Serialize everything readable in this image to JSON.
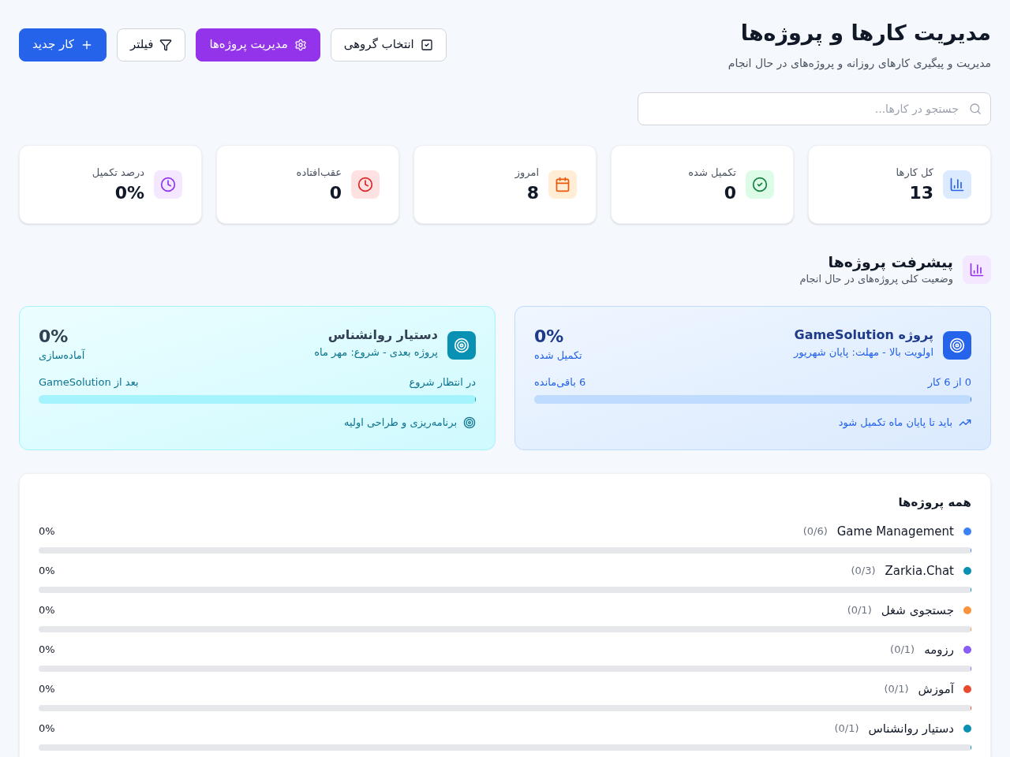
{
  "header": {
    "title": "مدیریت کارها و پروژه‌ها",
    "subtitle": "مدیریت و پیگیری کارهای روزانه و پروژه‌های در حال انجام"
  },
  "toolbar": [
    {
      "label": "انتخاب گروهی",
      "kind": "outline"
    },
    {
      "label": "مدیریت پروژه‌ها",
      "kind": "accent"
    },
    {
      "label": "فیلتر",
      "kind": "outline"
    },
    {
      "label": "کار جدید",
      "kind": "primary"
    }
  ],
  "search": {
    "placeholder": "جستجو در کارها..."
  },
  "stats": [
    {
      "label": "کل کارها",
      "value": "13"
    },
    {
      "label": "تکمیل شده",
      "value": "0"
    },
    {
      "label": "امروز",
      "value": "8"
    },
    {
      "label": "عقب‌افتاده",
      "value": "0"
    },
    {
      "label": "درصد تکمیل",
      "value": "0%"
    }
  ],
  "progress_section": {
    "title": "پیشرفت پروژه‌ها",
    "subtitle": "وضعیت کلی پروژه‌های در حال انجام"
  },
  "project_cards": [
    {
      "kind": "active",
      "title": "پروژه GameSolution",
      "subtitle": "اولویت بالا - مهلت: پایان شهریور",
      "percent": "0%",
      "status": "تکمیل شده",
      "progress_label": "0 از 6 کار",
      "progress_note": "6 باقی‌مانده",
      "level": 0,
      "footer": "باید تا پایان ماه تکمیل شود"
    },
    {
      "kind": "upcoming",
      "title": "دستیار روانشناس",
      "subtitle": "پروژه بعدی - شروع: مهر ماه",
      "percent": "0%",
      "status": "آماده‌سازی",
      "progress_label": "در انتظار شروع",
      "progress_note": "بعد از GameSolution",
      "level": 0,
      "footer": "برنامه‌ریزی و طراحی اولیه"
    }
  ],
  "all_projects": {
    "title": "همه پروژه‌ها",
    "rows": [
      {
        "name": "Game Management",
        "count": "(0/6)",
        "percent": "0%",
        "level": 0,
        "color": "#3b82f6"
      },
      {
        "name": "Zarkia.Chat",
        "count": "(0/3)",
        "percent": "0%",
        "level": 0,
        "color": "#0891b2"
      },
      {
        "name": "جستجوی شغل",
        "count": "(0/1)",
        "percent": "0%",
        "level": 0,
        "color": "#fb923c"
      },
      {
        "name": "رزومه",
        "count": "(0/1)",
        "percent": "0%",
        "level": 0,
        "color": "#8b5cf6"
      },
      {
        "name": "آموزش",
        "count": "(0/1)",
        "percent": "0%",
        "level": 0,
        "color": "#ea4a2f"
      },
      {
        "name": "دستیار روانشناس",
        "count": "(0/1)",
        "percent": "0%",
        "level": 0,
        "color": "#0891b2"
      }
    ]
  }
}
